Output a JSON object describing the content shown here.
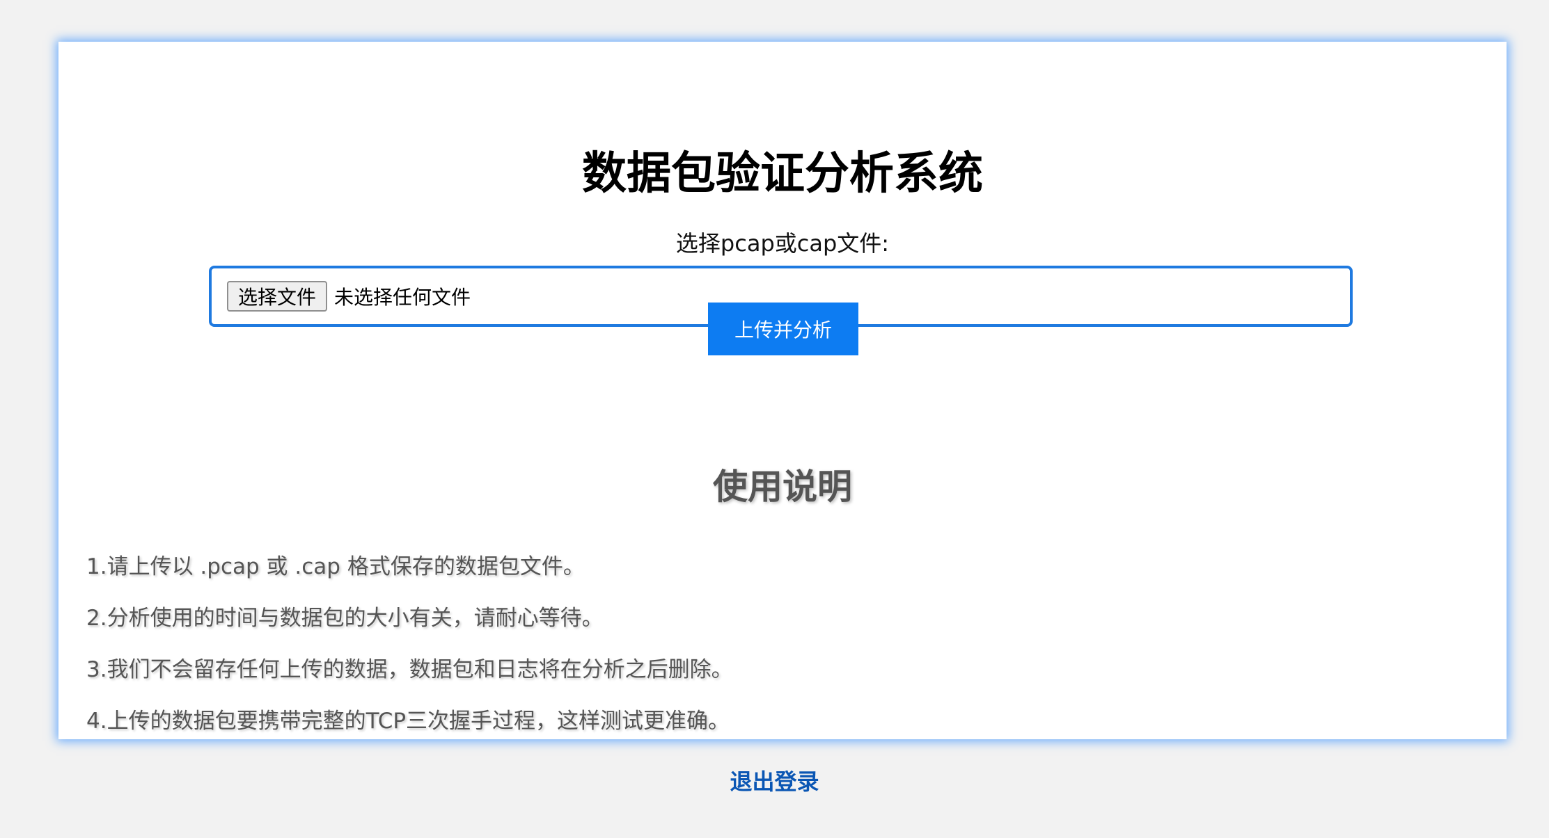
{
  "page": {
    "title": "数据包验证分析系统"
  },
  "upload": {
    "label": "选择pcap或cap文件:",
    "choose_button": "选择文件",
    "no_file_text": "未选择任何文件",
    "submit_button": "上传并分析"
  },
  "instructions": {
    "title": "使用说明",
    "items": [
      "1.请上传以 .pcap 或 .cap 格式保存的数据包文件。",
      "2.分析使用的时间与数据包的大小有关，请耐心等待。",
      "3.我们不会留存任何上传的数据，数据包和日志将在分析之后删除。",
      "4.上传的数据包要携带完整的TCP三次握手过程，这样测试更准确。"
    ]
  },
  "footer": {
    "logout_label": "退出登录"
  },
  "colors": {
    "accent": "#0d7cf2",
    "border": "#1f7ae0",
    "link": "#0a56b4",
    "background": "#f2f2f2"
  }
}
